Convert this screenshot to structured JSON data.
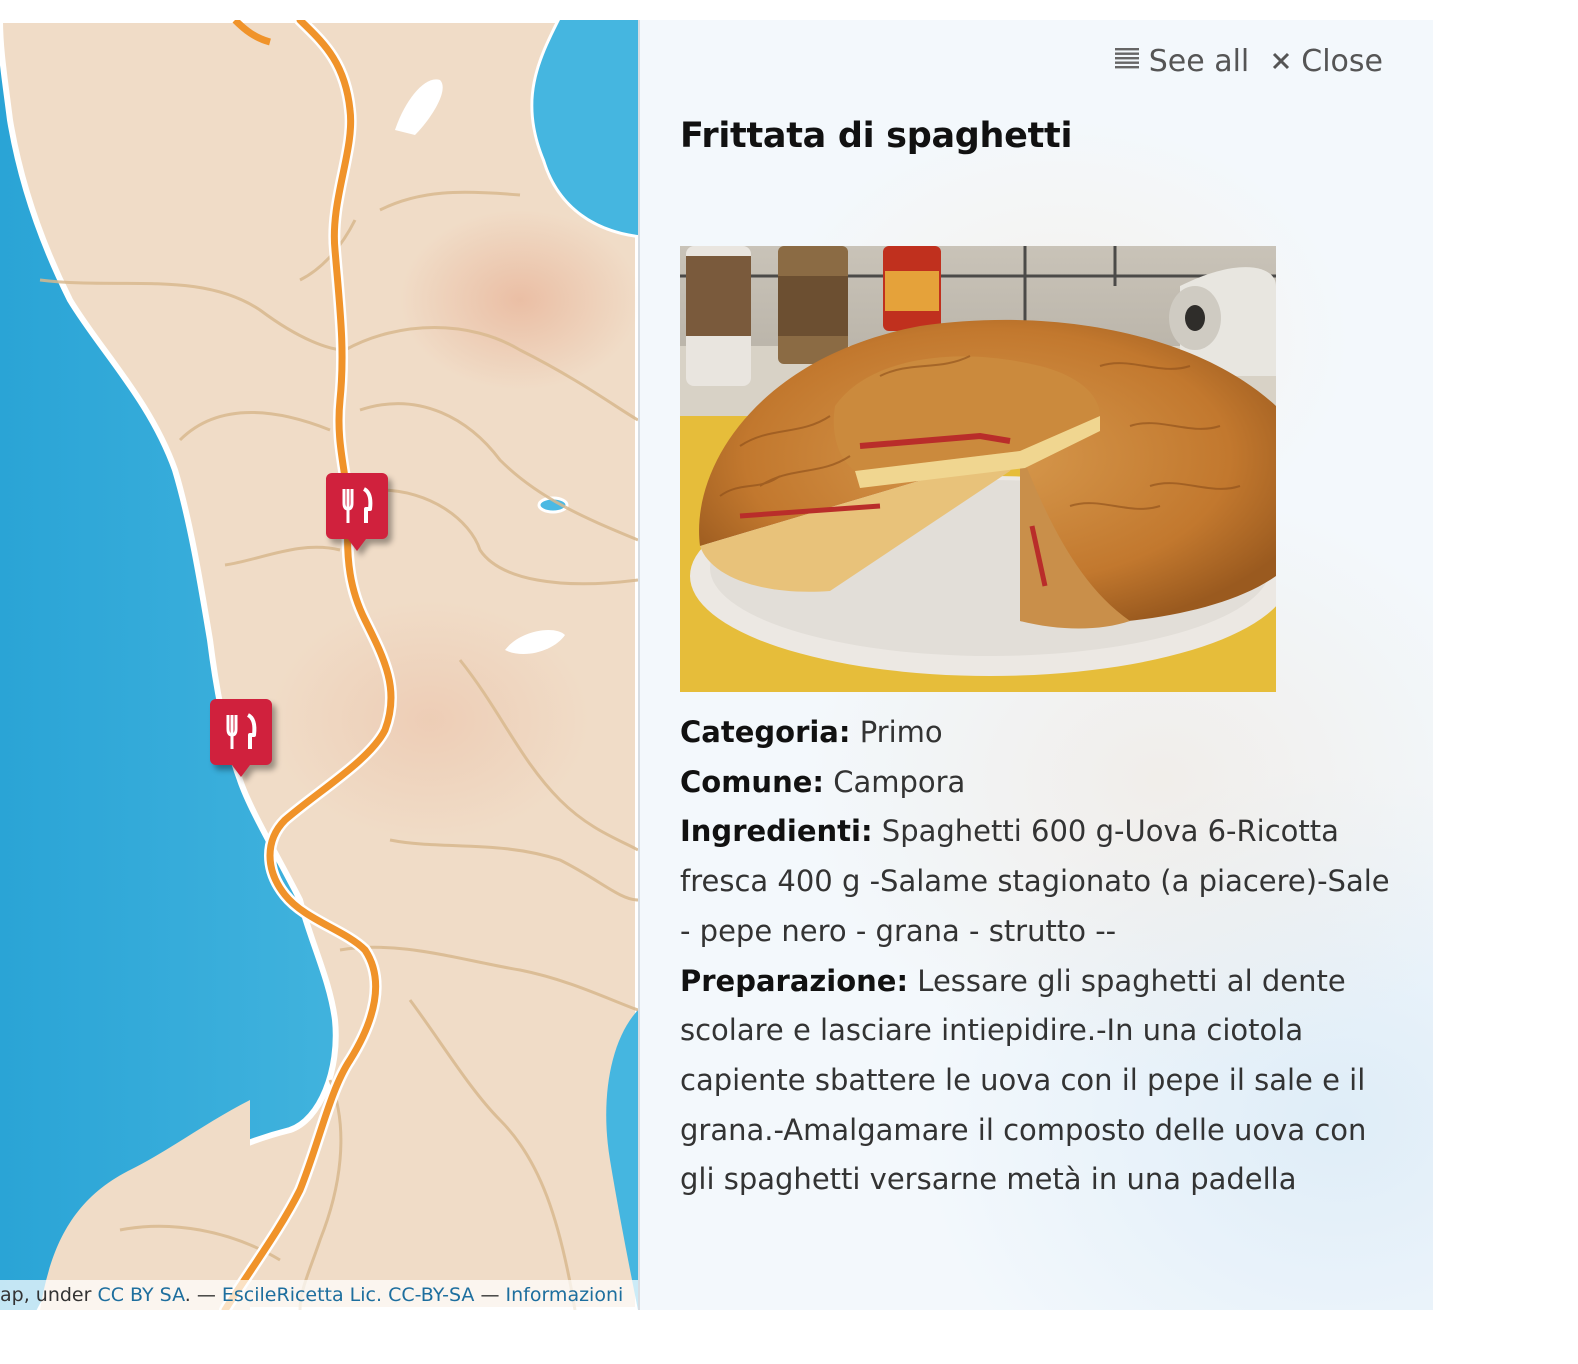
{
  "panel": {
    "see_all_label": "See all",
    "close_label": "Close",
    "see_all_icon": "list-icon",
    "close_icon": "close-icon"
  },
  "recipe": {
    "title": "Frittata di spaghetti",
    "photo_description": "frittata-photo",
    "fields": {
      "categoria_label": "Categoria:",
      "categoria_value": "Primo",
      "comune_label": "Comune:",
      "comune_value": "Campora",
      "ingredienti_label": "Ingredienti:",
      "ingredienti_value": "Spaghetti 600 g-Uova 6-Ricotta fresca 400 g -Salame stagionato (a piacere)-Sale - pepe nero - grana - strutto --",
      "preparazione_label": "Preparazione:",
      "preparazione_value": "Lessare gli spaghetti al dente scolare e lasciare intiepidire.-In una ciotola capiente sbattere le uova con il pepe il sale e il grana.-Amalgamare il composto delle uova con gli spaghetti versarne metà in una padella"
    }
  },
  "map": {
    "markers": [
      {
        "icon": "restaurant-icon"
      },
      {
        "icon": "restaurant-icon"
      }
    ],
    "attribution": {
      "prefix": "ap, under ",
      "license_link": "CC BY SA",
      "sep1": ". — ",
      "data_link": "EscileRicetta Lic. CC-BY-SA",
      "sep2": " — ",
      "info_link": "Informazioni"
    }
  },
  "colors": {
    "sea": "#3cb0dc",
    "land": "#f1ddc8",
    "road": "#f0932a",
    "marker": "#d0213d"
  }
}
